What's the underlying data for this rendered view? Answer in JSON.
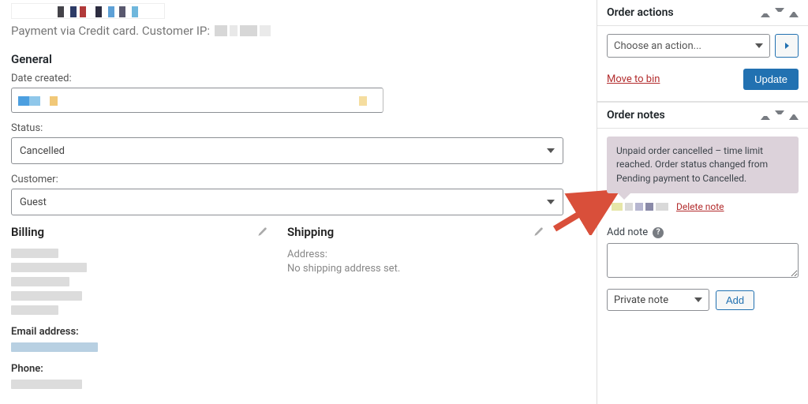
{
  "header": {
    "payment_line": "Payment via Credit card. Customer IP:"
  },
  "general": {
    "title": "General",
    "date_label": "Date created:",
    "status_label": "Status:",
    "status_value": "Cancelled",
    "customer_label": "Customer:",
    "customer_value": "Guest"
  },
  "billing": {
    "title": "Billing",
    "email_label": "Email address:",
    "phone_label": "Phone:"
  },
  "shipping": {
    "title": "Shipping",
    "addr_label": "Address:",
    "addr_text": "No shipping address set."
  },
  "order_actions": {
    "title": "Order actions",
    "placeholder": "Choose an action...",
    "move_to_bin": "Move to bin",
    "update": "Update"
  },
  "order_notes": {
    "title": "Order notes",
    "note_text": "Unpaid order cancelled – time limit reached. Order status changed from Pending payment to Cancelled.",
    "delete_note": "Delete note",
    "add_note_label": "Add note",
    "note_type": "Private note",
    "add_button": "Add"
  }
}
